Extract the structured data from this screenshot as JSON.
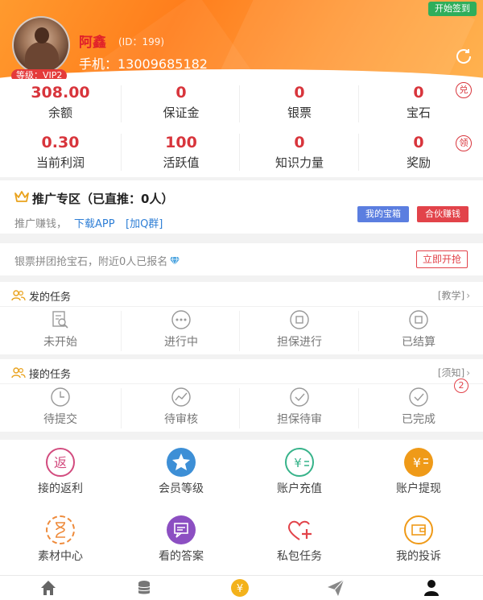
{
  "header": {
    "signin_label": "开始签到",
    "user_name": "阿鑫",
    "user_id": "(ID：199)",
    "phone": "手机：13009685182",
    "level_badge": "等级：VIP2"
  },
  "stats": [
    {
      "value": "308.00",
      "label": "余额"
    },
    {
      "value": "0",
      "label": "保证金"
    },
    {
      "value": "0",
      "label": "银票"
    },
    {
      "value": "0",
      "label": "宝石"
    },
    {
      "value": "0.30",
      "label": "当前利润"
    },
    {
      "value": "100",
      "label": "活跃值"
    },
    {
      "value": "0",
      "label": "知识力量"
    },
    {
      "value": "0",
      "label": "奖励"
    }
  ],
  "side_badges": {
    "top": "兑",
    "bottom": "领"
  },
  "promo": {
    "title": "推广专区（已直推：0人）",
    "text": "推广赚钱，",
    "download_link": "下载APP",
    "qq_link": "[加Q群]",
    "chest_button": "我的宝箱",
    "partner_button": "合伙赚钱"
  },
  "banner": {
    "text": "银票拼团抢宝石，附近0人已报名",
    "button": "立即开抢"
  },
  "published_tasks": {
    "title": "发的任务",
    "link": "[教学]",
    "items": [
      {
        "label": "未开始",
        "icon": "search-doc-icon"
      },
      {
        "label": "进行中",
        "icon": "dots-icon"
      },
      {
        "label": "担保进行",
        "icon": "square-circle-icon"
      },
      {
        "label": "已结算",
        "icon": "square-circle-icon"
      }
    ]
  },
  "accepted_tasks": {
    "title": "接的任务",
    "link": "[须知]",
    "badge": "2",
    "items": [
      {
        "label": "待提交",
        "icon": "clock-icon"
      },
      {
        "label": "待审核",
        "icon": "trend-icon"
      },
      {
        "label": "担保待审",
        "icon": "check-icon"
      },
      {
        "label": "已完成",
        "icon": "check-icon"
      }
    ]
  },
  "grid": [
    {
      "label": "接的返利",
      "icon": "rebate-icon"
    },
    {
      "label": "会员等级",
      "icon": "vip-icon"
    },
    {
      "label": "账户充值",
      "icon": "recharge-icon"
    },
    {
      "label": "账户提现",
      "icon": "withdraw-icon"
    },
    {
      "label": "素材中心",
      "icon": "hourglass-icon"
    },
    {
      "label": "看的答案",
      "icon": "answer-icon"
    },
    {
      "label": "私包任务",
      "icon": "heart-plus-icon"
    },
    {
      "label": "我的投诉",
      "icon": "complaint-icon"
    }
  ],
  "tabs": [
    {
      "icon": "home-icon"
    },
    {
      "icon": "coins-icon"
    },
    {
      "icon": "yen-coin-icon"
    },
    {
      "icon": "send-icon"
    },
    {
      "icon": "user-icon"
    }
  ]
}
